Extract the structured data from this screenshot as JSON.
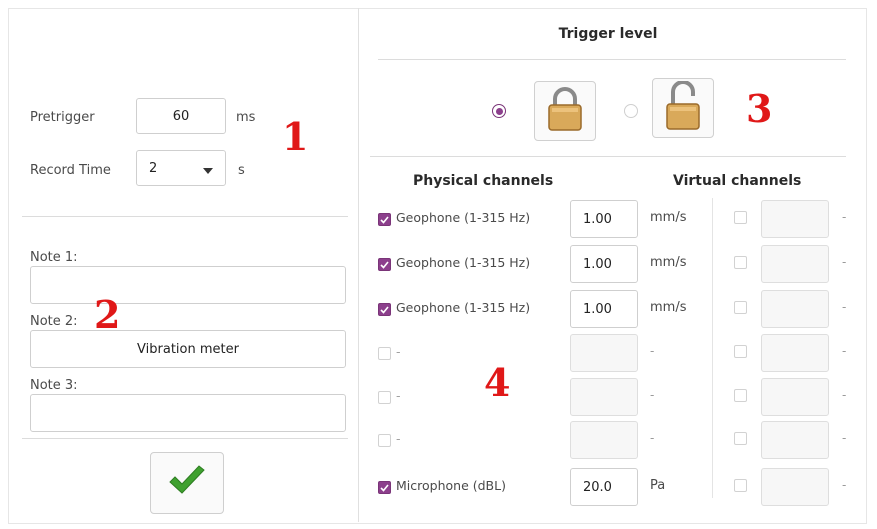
{
  "left": {
    "pretrigger_label": "Pretrigger",
    "pretrigger_value": "60",
    "pretrigger_unit": "ms",
    "record_time_label": "Record Time",
    "record_time_value": "2",
    "record_time_unit": "s",
    "notes": [
      {
        "label": "Note 1:",
        "value": ""
      },
      {
        "label": "Note 2:",
        "value": "Vibration meter"
      },
      {
        "label": "Note 3:",
        "value": ""
      }
    ]
  },
  "trigger": {
    "title": "Trigger level",
    "selected": "locked"
  },
  "channels": {
    "physical_header": "Physical channels",
    "virtual_header": "Virtual channels",
    "physical": [
      {
        "checked": true,
        "name": "Geophone (1-315 Hz)",
        "level": "1.00",
        "unit": "mm/s"
      },
      {
        "checked": true,
        "name": "Geophone (1-315 Hz)",
        "level": "1.00",
        "unit": "mm/s"
      },
      {
        "checked": true,
        "name": "Geophone (1-315 Hz)",
        "level": "1.00",
        "unit": "mm/s"
      },
      {
        "checked": false,
        "name": "-",
        "level": "",
        "unit": "-"
      },
      {
        "checked": false,
        "name": "-",
        "level": "",
        "unit": "-"
      },
      {
        "checked": false,
        "name": "-",
        "level": "",
        "unit": "-"
      },
      {
        "checked": true,
        "name": "Microphone (dBL)",
        "level": "20.0",
        "unit": "Pa"
      }
    ],
    "virtual": [
      {
        "checked": false,
        "value": "",
        "unit": "-"
      },
      {
        "checked": false,
        "value": "",
        "unit": "-"
      },
      {
        "checked": false,
        "value": "",
        "unit": "-"
      },
      {
        "checked": false,
        "value": "",
        "unit": "-"
      },
      {
        "checked": false,
        "value": "",
        "unit": "-"
      },
      {
        "checked": false,
        "value": "",
        "unit": "-"
      },
      {
        "checked": false,
        "value": "",
        "unit": "-"
      }
    ]
  },
  "annotations": {
    "a1": "1",
    "a2": "2",
    "a3": "3",
    "a4": "4"
  },
  "icons": {
    "ok": "checkmark-icon",
    "locked": "padlock-closed-icon",
    "unlocked": "padlock-open-icon",
    "dropdown": "caret-down-icon"
  },
  "colors": {
    "checkbox": "#8c3f8c",
    "annotation": "#e01818",
    "ok_green": "#3fa12f"
  }
}
